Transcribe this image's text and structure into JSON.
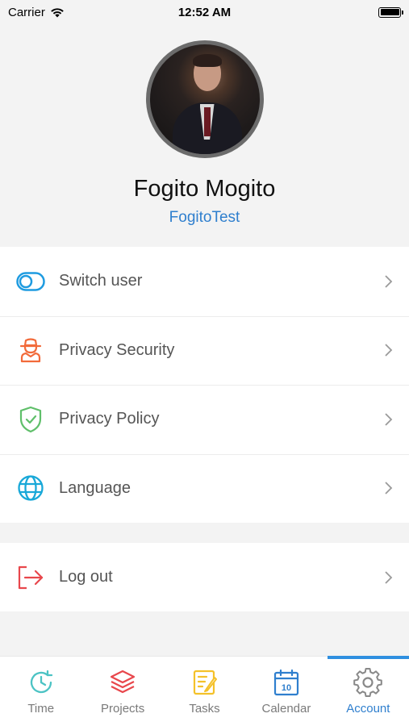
{
  "status_bar": {
    "carrier": "Carrier",
    "time": "12:52 AM"
  },
  "profile": {
    "name": "Fogito Mogito",
    "username": "FogitoTest"
  },
  "menu": {
    "items": [
      {
        "label": "Switch user",
        "icon": "toggle-icon",
        "color": "#1e9be0"
      },
      {
        "label": "Privacy Security",
        "icon": "user-secret-icon",
        "color": "#f26a3a"
      },
      {
        "label": "Privacy Policy",
        "icon": "shield-check-icon",
        "color": "#5fbf6a"
      },
      {
        "label": "Language",
        "icon": "globe-icon",
        "color": "#18a8d8"
      }
    ],
    "logout": {
      "label": "Log out",
      "icon": "logout-icon",
      "color": "#e8474c"
    }
  },
  "tabs": [
    {
      "label": "Time",
      "icon": "clock-icon",
      "color": "#4cc3c4"
    },
    {
      "label": "Projects",
      "icon": "layers-icon",
      "color": "#e8474c"
    },
    {
      "label": "Tasks",
      "icon": "tasks-icon",
      "color": "#f4c12a"
    },
    {
      "label": "Calendar",
      "icon": "calendar-icon",
      "color": "#2f7fce",
      "day": "10"
    },
    {
      "label": "Account",
      "icon": "gear-icon",
      "color": "#888888",
      "active": true
    }
  ],
  "colors": {
    "accent": "#2f7fce",
    "background": "#f3f3f3"
  }
}
